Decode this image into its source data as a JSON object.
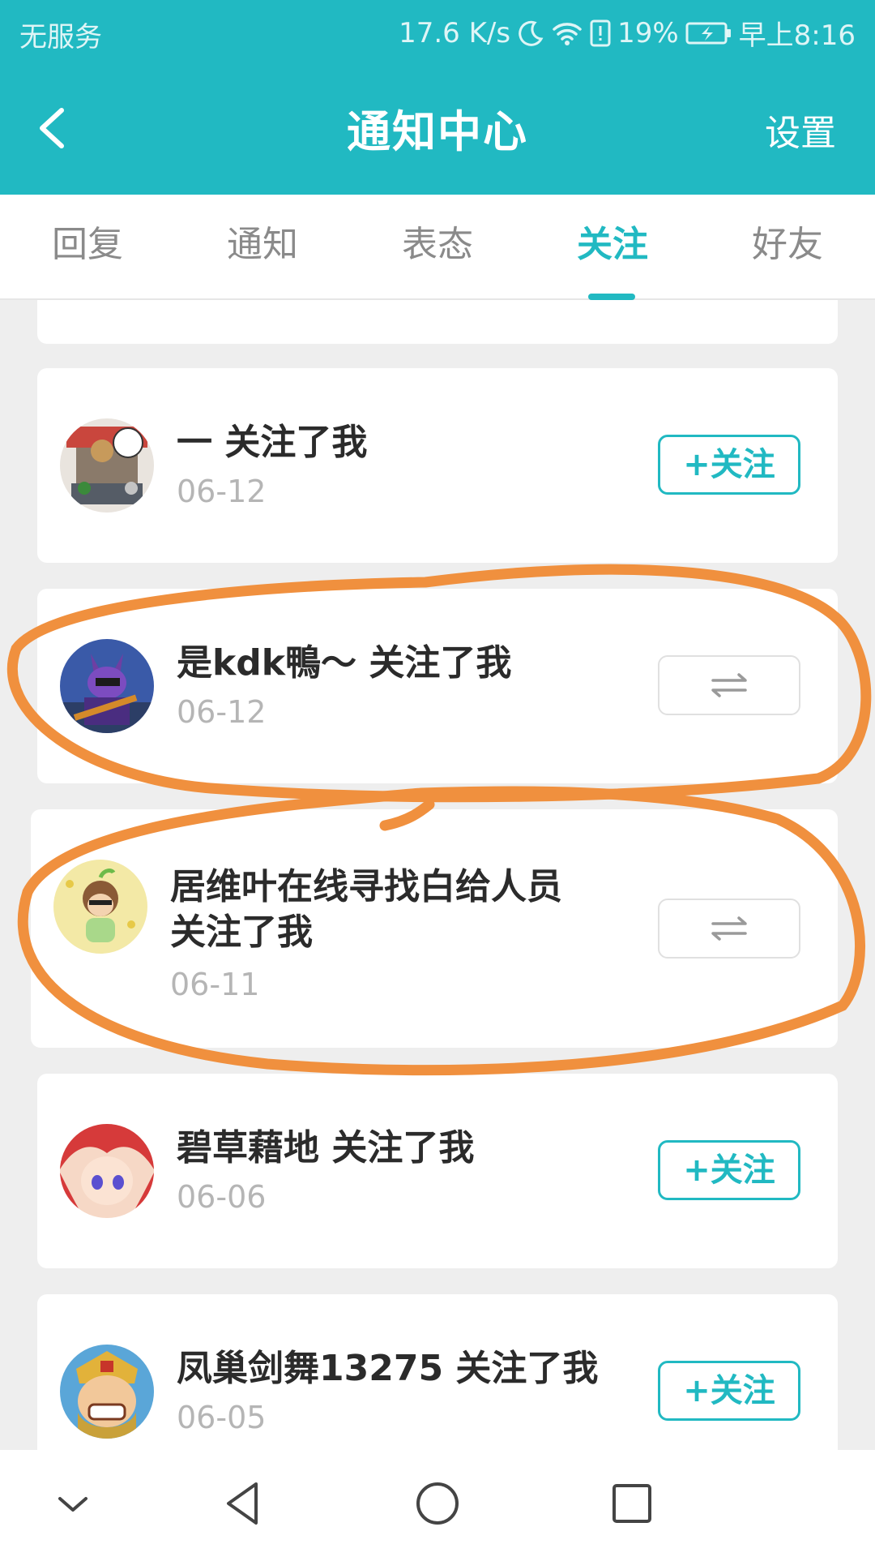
{
  "status_bar": {
    "carrier": "无服务",
    "speed": "17.6 K/s",
    "battery": "19%",
    "time": "早上8:16"
  },
  "header": {
    "title": "通知中心",
    "settings_label": "设置"
  },
  "tabs": [
    {
      "label": "回复",
      "active": false
    },
    {
      "label": "通知",
      "active": false
    },
    {
      "label": "表态",
      "active": false
    },
    {
      "label": "关注",
      "active": true
    },
    {
      "label": "好友",
      "active": false
    }
  ],
  "notifications": [
    {
      "name": "一",
      "action": "关注了我",
      "date": "06-12",
      "button": "+关注",
      "button_type": "follow",
      "highlighted": false
    },
    {
      "name": "是kdk鴨～",
      "action": "关注了我",
      "date": "06-12",
      "button": "⇆",
      "button_type": "mutual",
      "highlighted": true
    },
    {
      "name": "居维叶在线寻找白给人员",
      "action": "关注了我",
      "date": "06-11",
      "button": "⇆",
      "button_type": "mutual",
      "highlighted": true
    },
    {
      "name": "碧草藉地",
      "action": "关注了我",
      "date": "06-06",
      "button": "+关注",
      "button_type": "follow",
      "highlighted": false
    },
    {
      "name": "凤巢剑舞13275",
      "action": "关注了我",
      "date": "06-05",
      "button": "+关注",
      "button_type": "follow",
      "highlighted": false
    }
  ],
  "colors": {
    "accent": "#21b9c2",
    "annotation": "#f0903e",
    "background": "#eeeeee"
  },
  "nav_icons": [
    "chevron-down-icon",
    "back-triangle-icon",
    "home-circle-icon",
    "recent-square-icon"
  ]
}
